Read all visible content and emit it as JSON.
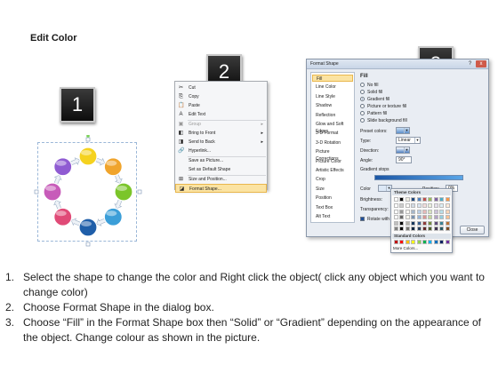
{
  "title": "Edit Color",
  "badges": [
    "1",
    "2",
    "3"
  ],
  "cycle_colors": [
    "#f5d21f",
    "#f0a42c",
    "#7bc52a",
    "#3b9ed8",
    "#1f5ea9",
    "#e04a77",
    "#c75bb9",
    "#8f5bd2"
  ],
  "context_menu": {
    "items": [
      {
        "label": "Cut",
        "icon": "cut-icon",
        "glyph": "✂",
        "disabled": false
      },
      {
        "label": "Copy",
        "icon": "copy-icon",
        "glyph": "⎘",
        "disabled": false
      },
      {
        "label": "Paste",
        "icon": "paste-icon",
        "glyph": "📋",
        "disabled": false
      },
      {
        "label": "Edit Text",
        "icon": "edit-text-icon",
        "glyph": "A",
        "disabled": false
      },
      {
        "label": "Group",
        "icon": "group-icon",
        "glyph": "▣",
        "disabled": true,
        "submenu": true
      },
      {
        "label": "Bring to Front",
        "icon": "bring-front-icon",
        "glyph": "◧",
        "disabled": false,
        "submenu": true
      },
      {
        "label": "Send to Back",
        "icon": "send-back-icon",
        "glyph": "◨",
        "disabled": false,
        "submenu": true
      },
      {
        "label": "Hyperlink...",
        "icon": "hyperlink-icon",
        "glyph": "🔗",
        "disabled": false
      },
      {
        "label": "Save as Picture...",
        "icon": "save-picture-icon",
        "glyph": "",
        "disabled": false
      },
      {
        "label": "Set as Default Shape",
        "icon": "default-shape-icon",
        "glyph": "",
        "disabled": false
      },
      {
        "label": "Size and Position...",
        "icon": "size-position-icon",
        "glyph": "⊞",
        "disabled": false
      },
      {
        "label": "Format Shape...",
        "icon": "format-shape-icon",
        "glyph": "◪",
        "disabled": false,
        "highlighted": true
      }
    ]
  },
  "dialog": {
    "title": "Format Shape",
    "close_glyph": "x",
    "help_glyph": "?",
    "nav": [
      "Fill",
      "Line Color",
      "Line Style",
      "Shadow",
      "Reflection",
      "Glow and Soft Edges",
      "3-D Format",
      "3-D Rotation",
      "Picture Corrections",
      "Picture Color",
      "Artistic Effects",
      "Crop",
      "Size",
      "Position",
      "Text Box",
      "Alt Text"
    ],
    "nav_selected": 0,
    "pane_title": "Fill",
    "options": [
      {
        "label": "No fill",
        "type": "radio",
        "on": false
      },
      {
        "label": "Solid fill",
        "type": "radio",
        "on": false
      },
      {
        "label": "Gradient fill",
        "type": "radio",
        "on": true
      },
      {
        "label": "Picture or texture fill",
        "type": "radio",
        "on": false
      },
      {
        "label": "Pattern fill",
        "type": "radio",
        "on": false
      },
      {
        "label": "Slide background fill",
        "type": "radio",
        "on": false
      }
    ],
    "preset_colors_label": "Preset colors:",
    "type_label": "Type:",
    "type_value": "Linear",
    "direction_label": "Direction:",
    "angle_label": "Angle:",
    "angle_value": "90°",
    "gradient_stops_label": "Gradient stops",
    "color_label": "Color",
    "position_label": "Position:",
    "position_value": "0%",
    "brightness_label": "Brightness:",
    "transparency_label": "Transparency:",
    "rotate_label": "Rotate with shape",
    "close_button": "Close"
  },
  "picker": {
    "theme_colors_label": "Theme Colors",
    "standard_colors_label": "Standard Colors",
    "more_colors_label": "More Colors...",
    "theme_top": [
      "#ffffff",
      "#000000",
      "#eeece1",
      "#1f497d",
      "#4f81bd",
      "#c0504d",
      "#9bbb59",
      "#8064a2",
      "#4bacc6",
      "#f79646"
    ],
    "standard": [
      "#c00000",
      "#ff0000",
      "#ffc000",
      "#ffff00",
      "#92d050",
      "#00b050",
      "#00b0f0",
      "#0070c0",
      "#002060",
      "#7030a0"
    ]
  },
  "instructions": [
    {
      "num": "1.",
      "text": "Select the shape to change the color and Right click the object( click any object which you want to change color)"
    },
    {
      "num": "2.",
      "text": "Choose Format Shape in the dialog box."
    },
    {
      "num": "3.",
      "text": "Choose “Fill” in the Format Shape box then “Solid” or “Gradient” depending on the appearance of the object. Change colour as shown in the picture."
    }
  ]
}
